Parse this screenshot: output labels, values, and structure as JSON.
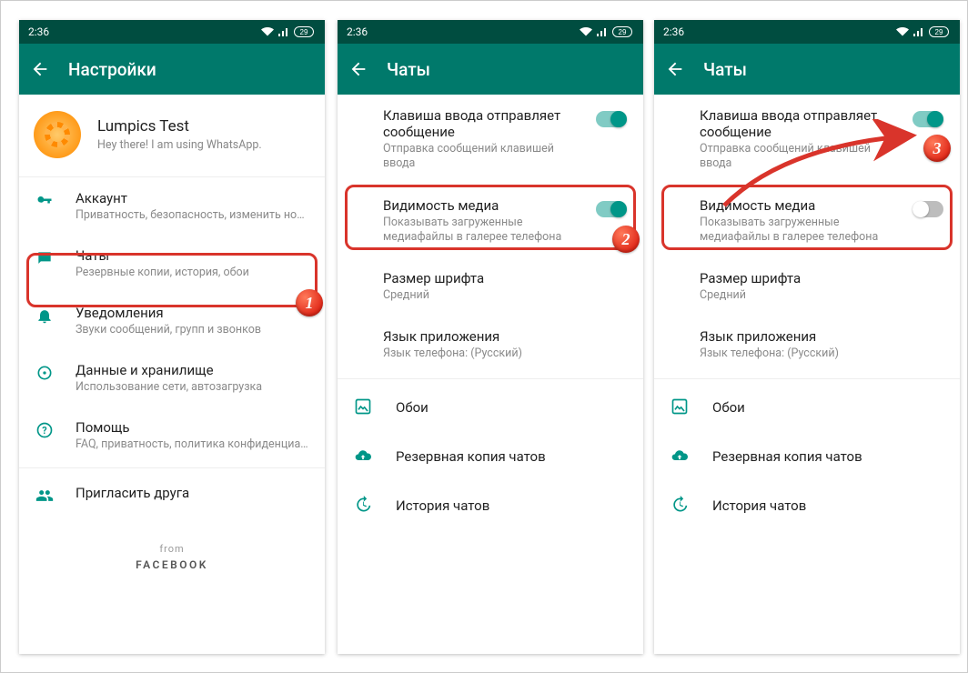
{
  "status": {
    "time": "2:36",
    "battery": "29"
  },
  "screens": {
    "settings": {
      "title": "Настройки",
      "profile_name": "Lumpics Test",
      "profile_status": "Hey there! I am using WhatsApp.",
      "items": [
        {
          "icon": "key",
          "title": "Аккаунт",
          "sub": "Приватность, безопасность, изменить номер"
        },
        {
          "icon": "chat",
          "title": "Чаты",
          "sub": "Резервные копии, история, обои"
        },
        {
          "icon": "bell",
          "title": "Уведомления",
          "sub": "Звуки сообщений, групп и звонков"
        },
        {
          "icon": "data",
          "title": "Данные и хранилище",
          "sub": "Использование сети, автозагрузка"
        },
        {
          "icon": "help",
          "title": "Помощь",
          "sub": "FAQ, приватность, политика конфиденциальн..."
        },
        {
          "icon": "invite",
          "title": "Пригласить друга",
          "sub": ""
        }
      ],
      "footer_from": "from",
      "footer_brand": "FACEBOOK"
    },
    "chats": {
      "title": "Чаты",
      "enter_send_title": "Клавиша ввода отправляет сообщение",
      "enter_send_sub": "Отправка сообщений клавишей ввода",
      "media_title": "Видимость медиа",
      "media_sub": "Показывать загруженные медиафайлы в галерее телефона",
      "font_title": "Размер шрифта",
      "font_value": "Средний",
      "lang_title": "Язык приложения",
      "lang_value": "Язык телефона: (Русский)",
      "rows": [
        {
          "icon": "wallpaper",
          "title": "Обои"
        },
        {
          "icon": "cloud",
          "title": "Резервная копия чатов"
        },
        {
          "icon": "history",
          "title": "История чатов"
        }
      ]
    }
  },
  "badges": {
    "b1": "1",
    "b2": "2",
    "b3": "3"
  }
}
